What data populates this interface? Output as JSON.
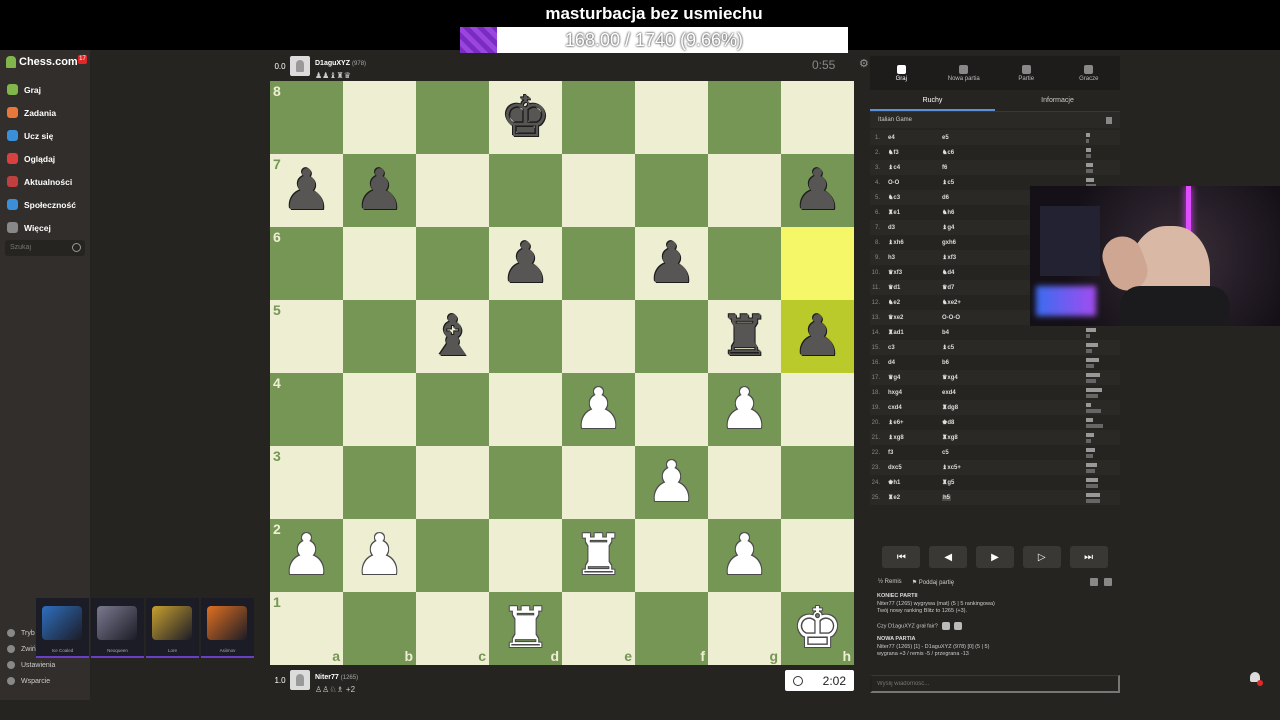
{
  "overlay": {
    "title": "masturbacja bez usmiechu",
    "progress_text": "168.00 / 1740 (9.66%)",
    "progress_fraction": 0.0966
  },
  "sidebar": {
    "logo": "Chess.com",
    "badge": "17",
    "items": [
      {
        "label": "Graj",
        "color": "#81b64c"
      },
      {
        "label": "Zadania",
        "color": "#e8773c"
      },
      {
        "label": "Ucz się",
        "color": "#3a8fd6"
      },
      {
        "label": "Oglądaj",
        "color": "#d94040"
      },
      {
        "label": "Aktualności",
        "color": "#c04040"
      },
      {
        "label": "Społeczność",
        "color": "#3a8fd6"
      },
      {
        "label": "Więcej",
        "color": "#888888"
      }
    ],
    "search_placeholder": "Szukaj",
    "bottom_items": [
      {
        "label": "Tryb"
      },
      {
        "label": "Zwiń"
      },
      {
        "label": "Ustawienia"
      },
      {
        "label": "Wsparcie"
      }
    ]
  },
  "skins": [
    {
      "label": "Ice Coaled",
      "color": "#2f6fbf"
    },
    {
      "label": "Neoqueen",
      "color": "#7a7a90"
    },
    {
      "label": "Lore",
      "color": "#c8a030"
    },
    {
      "label": "Asiimov",
      "color": "#e07020"
    }
  ],
  "players": {
    "top": {
      "score": "0.0",
      "name": "D1aguXYZ",
      "rating": "(978)",
      "captures": "♟♟♝♜♛",
      "clock": "0:55"
    },
    "bottom": {
      "score": "1.0",
      "name": "Niter77",
      "rating": "(1265)",
      "captures": "♙♙♘♗ +2",
      "clock": "2:02"
    }
  },
  "board": {
    "highlight": [
      "h6",
      "h5"
    ],
    "pieces": {
      "d8": "k",
      "a7": "p",
      "b7": "p",
      "h7": "p",
      "d6": "p",
      "f6": "p",
      "c5": "b",
      "g5": "r",
      "h5": "p",
      "e4": "P",
      "g4": "P",
      "f3": "P",
      "a2": "P",
      "b2": "P",
      "e2": "R",
      "g2": "P",
      "d1": "R",
      "h1": "K"
    }
  },
  "panel": {
    "tabs": [
      {
        "label": "Graj"
      },
      {
        "label": "Nowa partia"
      },
      {
        "label": "Partie"
      },
      {
        "label": "Gracze"
      }
    ],
    "subtabs": [
      {
        "label": "Ruchy"
      },
      {
        "label": "Informacje"
      }
    ],
    "opening": "Italian Game",
    "moves": [
      {
        "n": "1.",
        "w": "e4",
        "b": "e5"
      },
      {
        "n": "2.",
        "w": "♞f3",
        "b": "♞c6"
      },
      {
        "n": "3.",
        "w": "♝c4",
        "b": "f6"
      },
      {
        "n": "4.",
        "w": "O-O",
        "b": "♝c5"
      },
      {
        "n": "5.",
        "w": "♞c3",
        "b": "d6"
      },
      {
        "n": "6.",
        "w": "♜e1",
        "b": "♞h6"
      },
      {
        "n": "7.",
        "w": "d3",
        "b": "♝g4"
      },
      {
        "n": "8.",
        "w": "♝xh6",
        "b": "gxh6"
      },
      {
        "n": "9.",
        "w": "h3",
        "b": "♝xf3"
      },
      {
        "n": "10.",
        "w": "♛xf3",
        "b": "♞d4"
      },
      {
        "n": "11.",
        "w": "♛d1",
        "b": "♛d7"
      },
      {
        "n": "12.",
        "w": "♞e2",
        "b": "♞xe2+"
      },
      {
        "n": "13.",
        "w": "♛xe2",
        "b": "O-O-O"
      },
      {
        "n": "14.",
        "w": "♜ad1",
        "b": "b4"
      },
      {
        "n": "15.",
        "w": "c3",
        "b": "♝c5"
      },
      {
        "n": "16.",
        "w": "d4",
        "b": "b6"
      },
      {
        "n": "17.",
        "w": "♛g4",
        "b": "♛xg4"
      },
      {
        "n": "18.",
        "w": "hxg4",
        "b": "exd4"
      },
      {
        "n": "19.",
        "w": "cxd4",
        "b": "♜dg8"
      },
      {
        "n": "20.",
        "w": "♝e6+",
        "b": "♚d8"
      },
      {
        "n": "21.",
        "w": "♝xg8",
        "b": "♜xg8"
      },
      {
        "n": "22.",
        "w": "f3",
        "b": "c5"
      },
      {
        "n": "23.",
        "w": "dxc5",
        "b": "♝xc5+"
      },
      {
        "n": "24.",
        "w": "♚h1",
        "b": "♜g5"
      },
      {
        "n": "25.",
        "w": "♜e2",
        "b": "h5"
      }
    ],
    "actions": {
      "draw": "Remis",
      "resign": "Poddaj partię"
    },
    "chat": {
      "game_over": "KONIEC PARTII",
      "result": "Niter77 (1265) wygrywa (mat) (5 | 5 rankingowa)",
      "rating_new": "Twój nowy ranking Blitz to 1265 (+3).",
      "fair_q": "Czy D1aguXYZ grał fair?",
      "new_game": "NOWA PARTIA",
      "new_game_line": "Niter77 (1265) [1] - D1aguXYZ (978) [0] (5 | 5)",
      "stats": "wygrana +3 / remis -5 / przegrana -13"
    },
    "chat_placeholder": "Wyślij wiadomość..."
  }
}
